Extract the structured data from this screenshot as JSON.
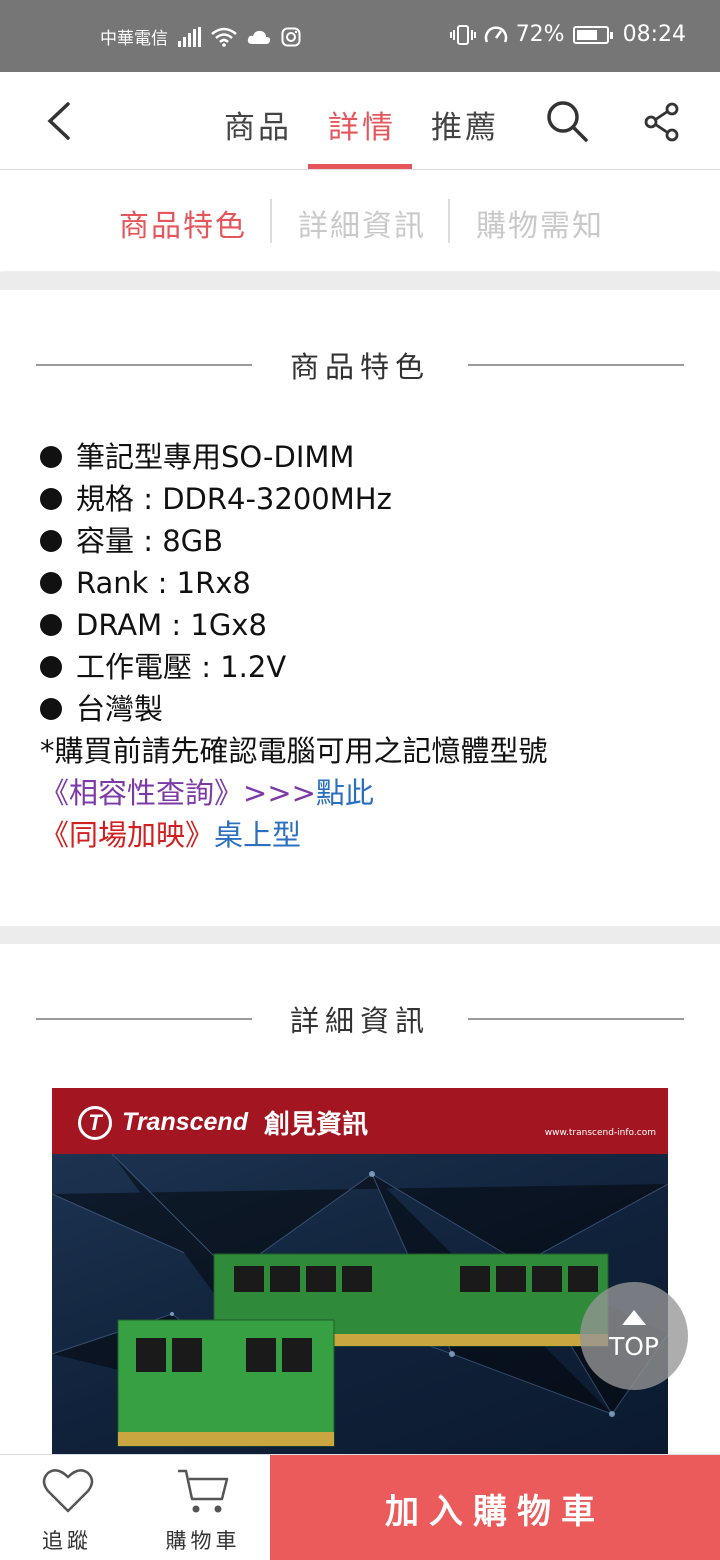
{
  "status_bar": {
    "carrier": "中華電信",
    "battery": "72%",
    "time": "08:24"
  },
  "header": {
    "tabs": [
      {
        "label": "商品"
      },
      {
        "label": "詳情"
      },
      {
        "label": "推薦"
      }
    ],
    "active_tab": "詳情"
  },
  "sub_tabs": {
    "items": [
      {
        "label": "商品特色"
      },
      {
        "label": "詳細資訊"
      },
      {
        "label": "購物需知"
      }
    ],
    "active": "商品特色"
  },
  "features_section": {
    "title": "商品特色",
    "items": [
      "筆記型專用SO-DIMM",
      "規格 : DDR4-3200MHz",
      "容量 : 8GB",
      "Rank : 1Rx8",
      "DRAM : 1Gx8",
      "工作電壓 : 1.2V",
      "台灣製"
    ],
    "note": "*購買前請先確認電腦可用之記憶體型號",
    "compat_link": {
      "prefix": "《相容性查詢》",
      "arrows": ">>>",
      "text": "點此"
    },
    "promo_link": {
      "prefix": "《同場加映》",
      "text": "桌上型"
    }
  },
  "details_section": {
    "title": "詳細資訊",
    "banner": {
      "brand": "Transcend",
      "brand_cn": "創見資訊",
      "url": "www.transcend-info.com"
    }
  },
  "top_button": {
    "label": "TOP"
  },
  "bottom_bar": {
    "track_label": "追蹤",
    "cart_label": "購物車",
    "add_to_cart_label": "加入購物車"
  },
  "colors": {
    "accent": "#e4565b",
    "cta": "#ec5b5b",
    "status_bar": "#767676"
  }
}
